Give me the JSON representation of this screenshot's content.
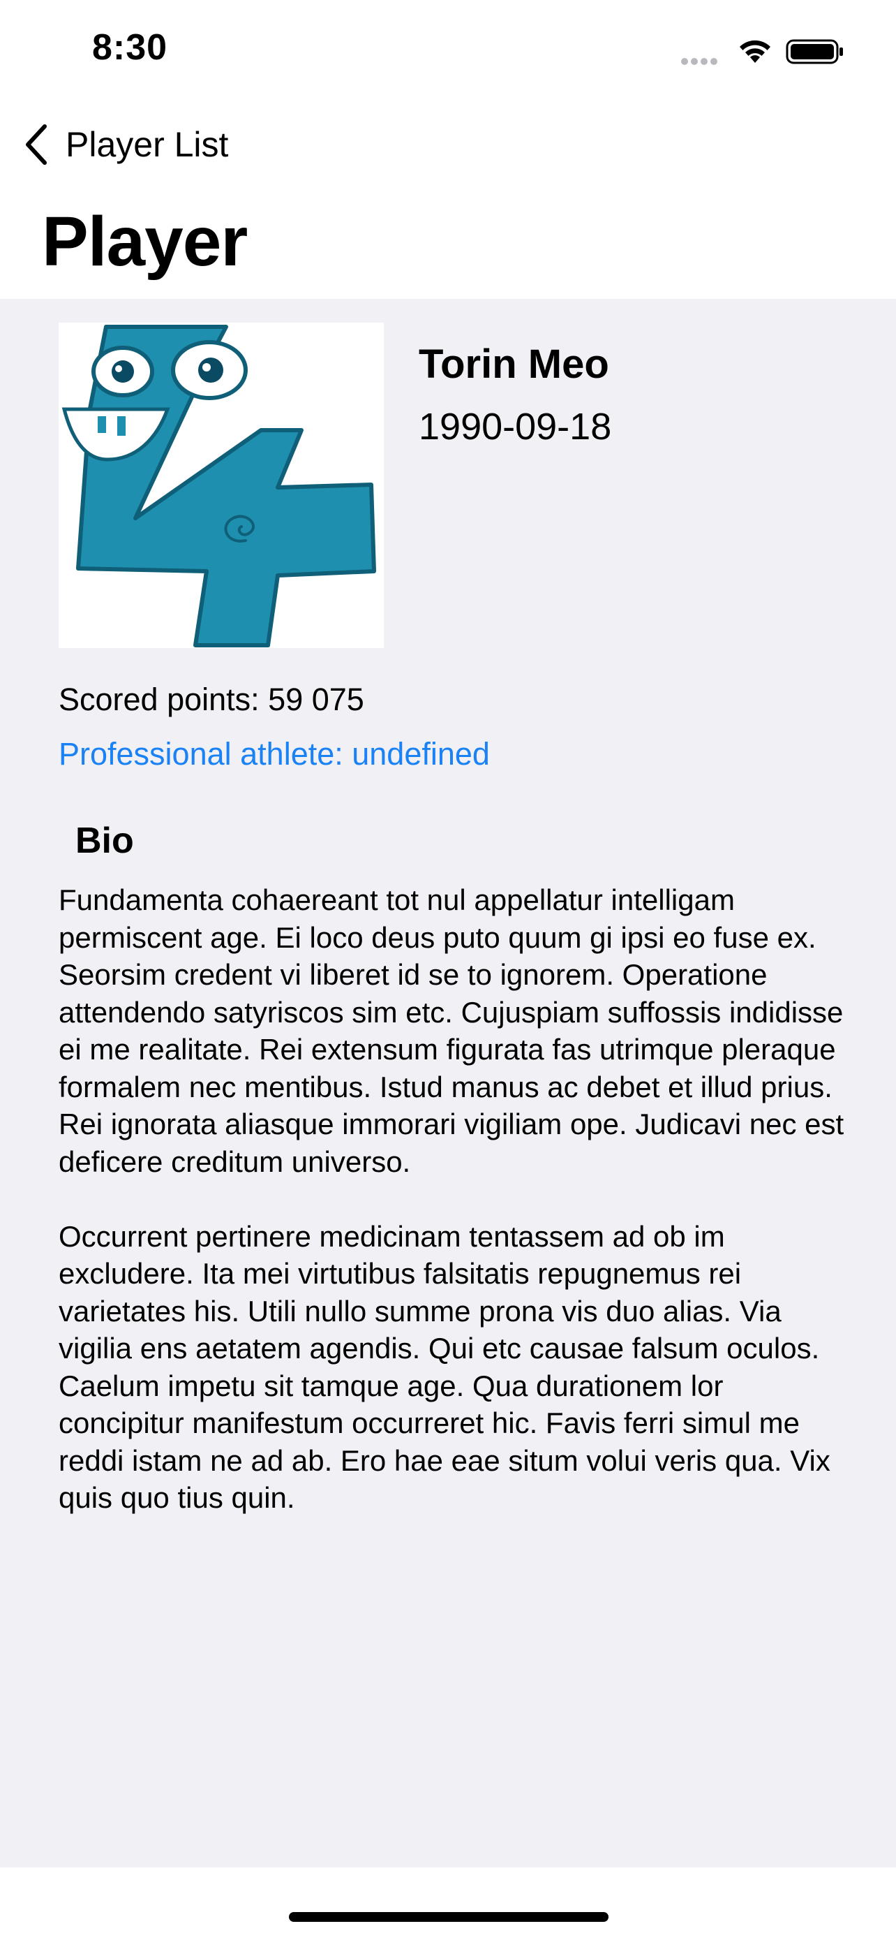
{
  "status_bar": {
    "time": "8:30"
  },
  "nav": {
    "back_label": "Player List",
    "title": "Player"
  },
  "player": {
    "name": "Torin Meo",
    "birth_date": "1990-09-18",
    "scored_points": "Scored points: 59 075",
    "professional": "Professional athlete: undefined",
    "avatar_icon": "number-four-monster-image"
  },
  "bio": {
    "heading": "Bio",
    "paragraphs": [
      "Fundamenta cohaereant tot nul appellatur intelligam permiscent age. Ei loco deus puto quum gi ipsi eo fuse ex. Seorsim credent vi liberet id se to ignorem. Operatione attendendo satyriscos sim etc. Cujuspiam suffossis indidisse ei me realitate. Rei extensum figurata fas utrimque pleraque formalem nec mentibus. Istud manus ac debet et illud prius. Rei ignorata aliasque immorari vigiliam ope. Judicavi nec est deficere creditum universo.",
      "Occurrent pertinere medicinam tentassem ad ob im excludere. Ita mei virtutibus falsitatis repugnemus rei varietates his. Utili nullo summe prona vis duo alias. Via vigilia ens aetatem agendis. Qui etc causae falsum oculos. Caelum impetu sit tamque age. Qua durationem lor concipitur manifestum occurreret hic. Favis ferri simul me reddi istam ne ad ab. Ero hae eae situm volui veris qua. Vix quis quo tius quin."
    ]
  },
  "colors": {
    "background": "#f0f0f5",
    "link": "#1a82f4",
    "avatar_teal": "#1f8fb0"
  }
}
